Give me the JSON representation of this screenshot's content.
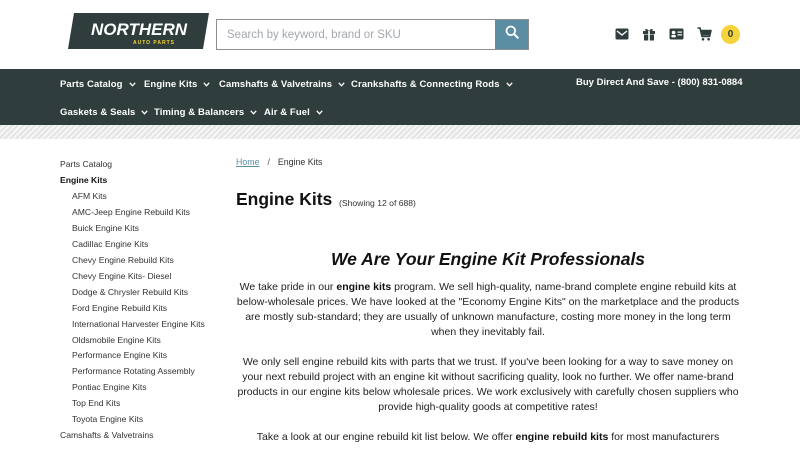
{
  "header": {
    "logo_text": "NORTHERN",
    "logo_subtext": "AUTO PARTS",
    "search_placeholder": "Search by keyword, brand or SKU",
    "cart_count": "0",
    "icons": [
      "search-icon",
      "mail-icon",
      "gift-icon",
      "contact-card-icon",
      "cart-icon"
    ]
  },
  "nav": {
    "row1": [
      "Parts Catalog",
      "Engine Kits",
      "Camshafts & Valvetrains",
      "Crankshafts & Connecting Rods"
    ],
    "row2": [
      "Gaskets & Seals",
      "Timing & Balancers",
      "Air & Fuel"
    ],
    "phone": "Buy Direct And Save - (800) 831-0884"
  },
  "sidebar": {
    "items": [
      "Parts Catalog",
      "Engine Kits",
      "AFM Kits",
      "AMC-Jeep Engine Rebuild Kits",
      "Buick Engine Kits",
      "Cadillac Engine Kits",
      "Chevy Engine Rebuild Kits",
      "Chevy Engine Kits- Diesel",
      "Dodge & Chrysler Rebuild Kits",
      "Ford Engine Rebuild Kits",
      "International Harvester Engine Kits",
      "Oldsmobile Engine Kits",
      "Performance Engine Kits",
      "Performance Rotating Assembly",
      "Pontiac Engine Kits",
      "Top End Kits",
      "Toyota Engine Kits",
      "Camshafts & Valvetrains"
    ]
  },
  "breadcrumb": {
    "home": "Home",
    "sep": "/",
    "current": "Engine Kits"
  },
  "main": {
    "title": "Engine Kits",
    "showing": "(Showing 12 of 688)",
    "headline": "We Are Your Engine Kit Professionals",
    "p1_a": "We take pride in our ",
    "p1_b": "engine kits",
    "p1_c": " program. We sell high-quality, name-brand complete engine rebuild kits at below-wholesale prices. We have looked at the \"Economy Engine Kits\" on the marketplace and the products are mostly sub-standard; they are usually of unknown manufacture, costing more money in the long term when they inevitably fail.",
    "p2": "We only sell engine rebuild kits with parts that we trust. If you've been looking for a way to save money on your next rebuild project with an engine kit without sacrificing quality, look no further. We offer name-brand products in our engine kits below wholesale prices. We work exclusively with carefully chosen suppliers who provide high-quality goods at competitive rates!",
    "p3_a": "Take a look at our engine rebuild kit list below. We offer ",
    "p3_b": "engine rebuild kits",
    "p3_c": " for most manufacturers"
  },
  "colors": {
    "nav_bg": "#2f3d3d",
    "search_btn": "#5b8da3",
    "badge": "#f5d33a",
    "link": "#5b8da3"
  }
}
